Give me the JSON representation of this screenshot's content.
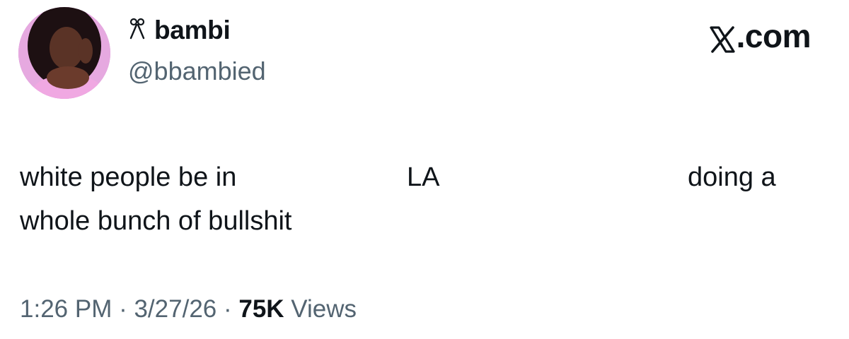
{
  "author": {
    "badge_icon": "bow-icon",
    "badge_glyph": "ᯓ",
    "display_name": "bambi",
    "handle": "@bbambied"
  },
  "brand": {
    "label": ".com",
    "icon": "x-logo-icon"
  },
  "tweet": {
    "line1_part1": "white people be in",
    "line1_part2": "LA",
    "line1_part3": "doing a",
    "line2": "whole bunch of bullshit"
  },
  "meta": {
    "time": "1:26 PM",
    "separator1": " · ",
    "date": "3/27/26",
    "separator2": " · ",
    "views_count": "75K",
    "views_label": " Views"
  },
  "colors": {
    "text": "#0f1419",
    "secondary": "#536471",
    "avatar_pink": "#d98cd6"
  }
}
